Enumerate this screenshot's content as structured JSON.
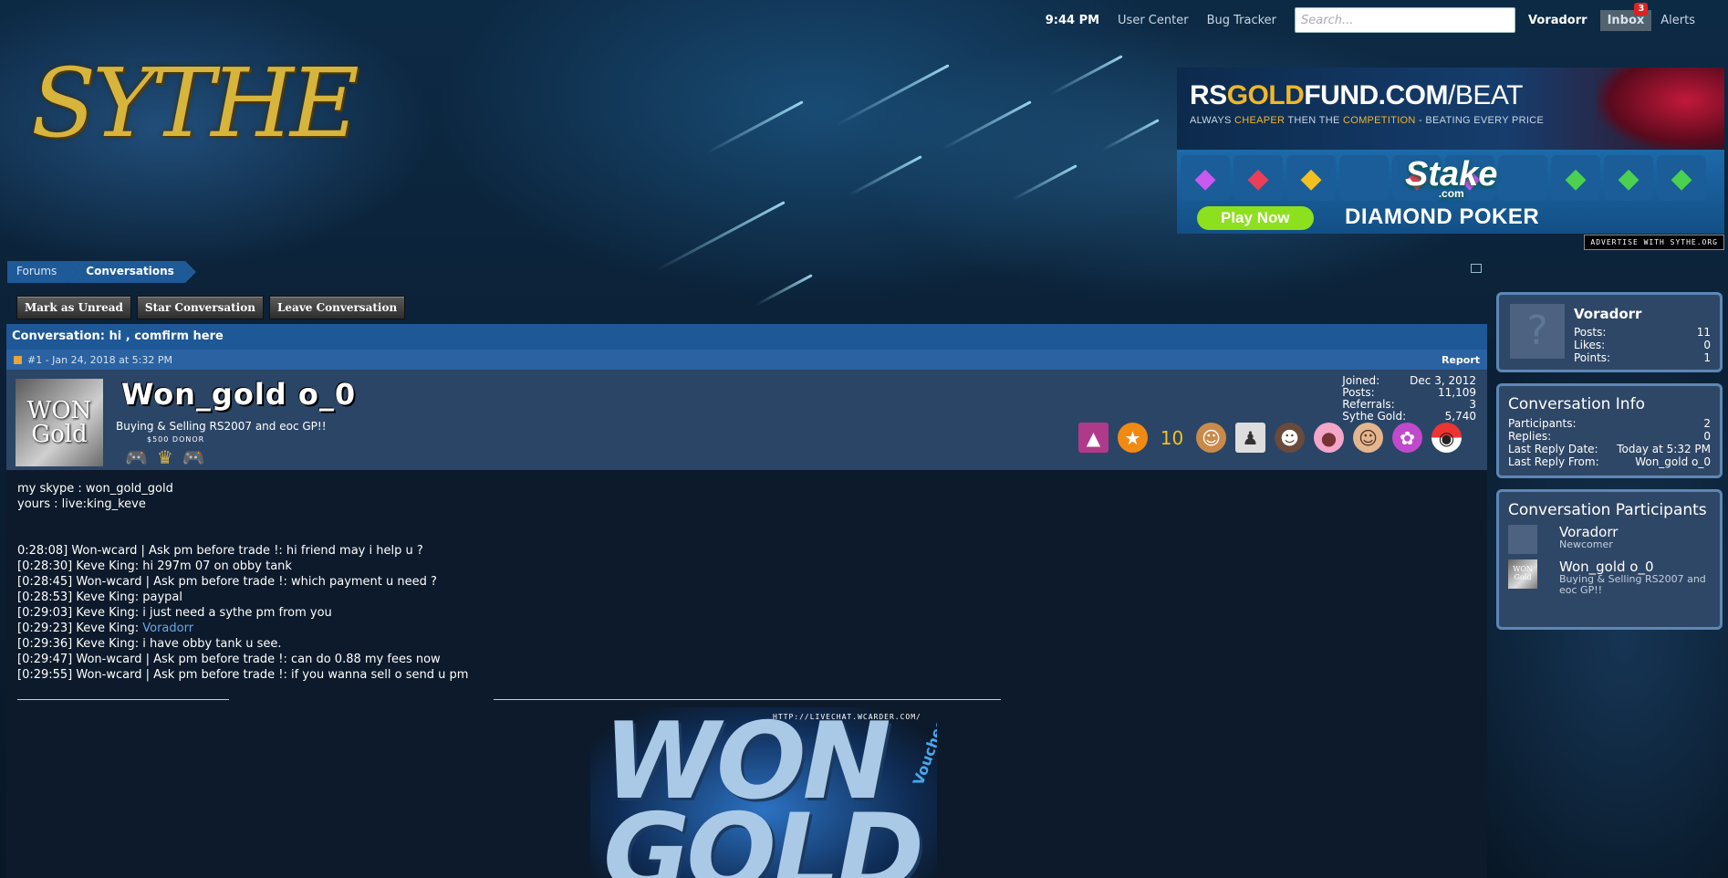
{
  "topbar": {
    "time": "9:44 PM",
    "user_center": "User Center",
    "bug_tracker": "Bug Tracker",
    "search_placeholder": "Search...",
    "username": "Voradorr",
    "inbox_label": "Inbox",
    "inbox_count": "3",
    "alerts_label": "Alerts"
  },
  "logo": {
    "text": "SYTHE"
  },
  "ad": {
    "brand_part1": "RS",
    "brand_part2": "GOLD",
    "brand_part3": "FUND.COM",
    "brand_part4": "/BEAT",
    "tagline_1": "ALWAYS ",
    "tagline_2": "CHEAPER",
    "tagline_3": " THEN THE ",
    "tagline_4": "COMPETITION",
    "tagline_5": " - BEATING EVERY PRICE",
    "stake_name": "Stake",
    "stake_domain": ".com",
    "play_now": "Play Now",
    "poker": "DIAMOND POKER",
    "advertise": "ADVERTISE WITH SYTHE.ORG"
  },
  "breadcrumb": {
    "forums": "Forums",
    "conversations": "Conversations"
  },
  "actions": {
    "mark_unread": "Mark as Unread",
    "star": "Star Conversation",
    "leave": "Leave Conversation"
  },
  "conversation": {
    "title": "Conversation: hi , comfirm here",
    "post_meta": "#1 - Jan 24, 2018 at 5:32 PM",
    "report": "Report"
  },
  "author": {
    "avatar_line1": "WON",
    "avatar_line2": "Gold",
    "name": "Won_gold o_0",
    "title": "Buying & Selling RS2007 and eoc GP!!",
    "donor": "$500 DONOR",
    "stats": [
      {
        "label": "Joined:",
        "value": "Dec 3, 2012"
      },
      {
        "label": "Posts:",
        "value": "11,109"
      },
      {
        "label": "Referrals:",
        "value": "3"
      },
      {
        "label": "Sythe Gold:",
        "value": "5,740"
      }
    ]
  },
  "message": {
    "lines": [
      "my skype : won_gold_gold",
      "yours : live:king_keve",
      "",
      "",
      "0:28:08] Won-wcard | Ask pm before trade !: hi friend may i help u ?",
      "[0:28:30] Keve King: hi 297m 07 on obby tank",
      "[0:28:45] Won-wcard | Ask pm before trade !: which payment u need ?",
      "[0:28:53] Keve King: paypal",
      "[0:29:03] Keve King: i just need a sythe pm from you"
    ],
    "line_mention_prefix": "[0:29:23] Keve King: ",
    "line_mention_name": "Voradorr",
    "lines_after": [
      "[0:29:36] Keve King: i have obby tank u see.",
      "[0:29:47] Won-wcard | Ask pm before trade !: can do 0.88 my fees now",
      "[0:29:55] Won-wcard | Ask pm before trade !: if you wanna sell o send u pm"
    ]
  },
  "signature": {
    "url": "HTTP://LIVECHAT.WCARDER.COM/",
    "big": "WON GOLD",
    "side": "Vouches"
  },
  "sidebar": {
    "user": {
      "name": "Voradorr",
      "posts_label": "Posts:",
      "posts": "11",
      "likes_label": "Likes:",
      "likes": "0",
      "points_label": "Points:",
      "points": "1"
    },
    "info": {
      "heading": "Conversation Info",
      "rows": [
        {
          "label": "Participants:",
          "value": "2"
        },
        {
          "label": "Replies:",
          "value": "0"
        },
        {
          "label": "Last Reply Date:",
          "value": "Today at 5:32 PM"
        },
        {
          "label": "Last Reply From:",
          "value": "Won_gold o_0"
        }
      ]
    },
    "participants": {
      "heading": "Conversation Participants",
      "people": [
        {
          "name": "Voradorr",
          "sub": "Newcomer"
        },
        {
          "name": "Won_gold o_0",
          "sub": "Buying & Selling RS2007 and eoc GP!!"
        }
      ]
    }
  }
}
